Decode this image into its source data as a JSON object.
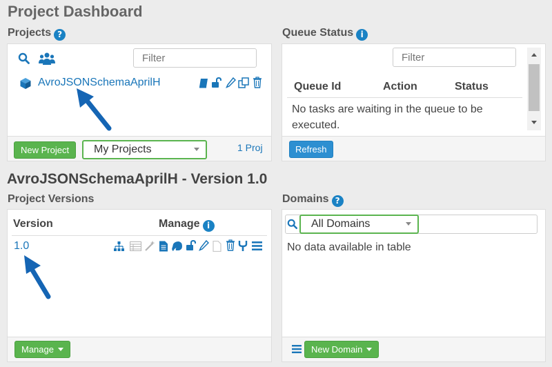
{
  "page_title": "Project Dashboard",
  "projects": {
    "heading": "Projects",
    "filter_placeholder": "Filter",
    "project_name": "AvroJSONSchemaAprilH",
    "new_project_label": "New Project",
    "scope_selected": "My Projects",
    "count_text": "1 Proj"
  },
  "queue": {
    "heading": "Queue Status",
    "filter_placeholder": "Filter",
    "columns": [
      "Queue Id",
      "Action",
      "Status"
    ],
    "empty_text": "No tasks are waiting in the queue to be executed.",
    "refresh_label": "Refresh"
  },
  "version_title": "AvroJSONSchemaAprilH - Version 1.0",
  "versions": {
    "heading": "Project Versions",
    "col_version": "Version",
    "col_manage": "Manage",
    "rows": [
      {
        "version": "1.0"
      }
    ],
    "manage_label": "Manage"
  },
  "domains": {
    "heading": "Domains",
    "select_value": "All Domains",
    "empty_text": "No data available in table",
    "new_domain_label": "New Domain"
  },
  "colors": {
    "accent_blue": "#1a76b9",
    "button_green": "#5ab44e",
    "button_blue": "#2d8fd1",
    "annotation_arrow": "#1565b4"
  },
  "icons": {
    "project_row_actions": [
      "book-icon",
      "unlock-icon",
      "pencil-icon",
      "copy-icon",
      "trash-icon"
    ],
    "version_row_actions": [
      "hierarchy-icon",
      "table-icon",
      "wand-icon",
      "document-icon",
      "elephant-icon",
      "unlock-icon",
      "pencil-icon",
      "blank-document-icon",
      "trash-icon",
      "fork-icon",
      "menu-icon"
    ]
  }
}
